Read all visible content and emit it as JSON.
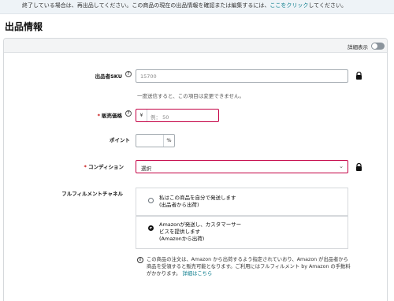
{
  "banner": {
    "text": "終了している場合は、再出品してください。この商品の現在の出品情報を確認または編集するには、",
    "link": "ここをクリック",
    "suffix": "してください。"
  },
  "section_title": "出品情報",
  "details_toggle": {
    "label": "詳細表示",
    "on": false
  },
  "sku": {
    "label": "出品者SKU",
    "value": "15700",
    "note": "一度送信すると、この項目は変更できません。"
  },
  "price": {
    "required_mark": "*",
    "label": "販売価格",
    "currency": "¥",
    "placeholder": "例： 50"
  },
  "points": {
    "label": "ポイント",
    "unit": "%"
  },
  "condition": {
    "required_mark": "*",
    "label": "コンディション",
    "selected": "選択"
  },
  "fulfillment": {
    "label": "フルフィルメントチャネル",
    "options": [
      {
        "line1": "私はこの商品を自分で発送します",
        "line2": "(出品者から出荷)",
        "selected": false
      },
      {
        "line1": "Amazonが発送し、カスタマーサー",
        "line2": "ビスを提供します",
        "line3": "(Amazonから出荷)",
        "selected": true
      }
    ]
  },
  "info": {
    "text": "この商品の注文は、Amazon から出荷するよう指定されていおり、Amazon が出品者から商品を受領すると販売可能となります。ご利用にはフルフィルメント by Amazon の手数料がかかります。",
    "link": "詳細はこちら"
  }
}
